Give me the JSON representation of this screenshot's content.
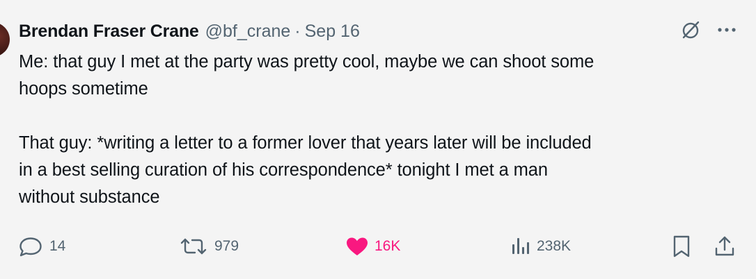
{
  "author": {
    "name": "Brendan Fraser Crane",
    "handle": "@bf_crane",
    "separator": "·",
    "date": "Sep 16"
  },
  "tweet": {
    "text": "Me: that guy I met at the party was pretty cool, maybe we can shoot some\nhoops sometime\n\nThat guy: *writing a letter to a former lover that years later will be included\nin a best selling curation of his correspondence* tonight I met a man\nwithout substance"
  },
  "header_icons": {
    "grok": "grok-slash-icon",
    "more": "more-dots-icon"
  },
  "actions": {
    "replies": "14",
    "reposts": "979",
    "likes": "16K",
    "views": "238K"
  },
  "colors": {
    "background": "#f4f4f4",
    "text": "#0f1419",
    "muted": "#536471",
    "like": "#f91880"
  }
}
